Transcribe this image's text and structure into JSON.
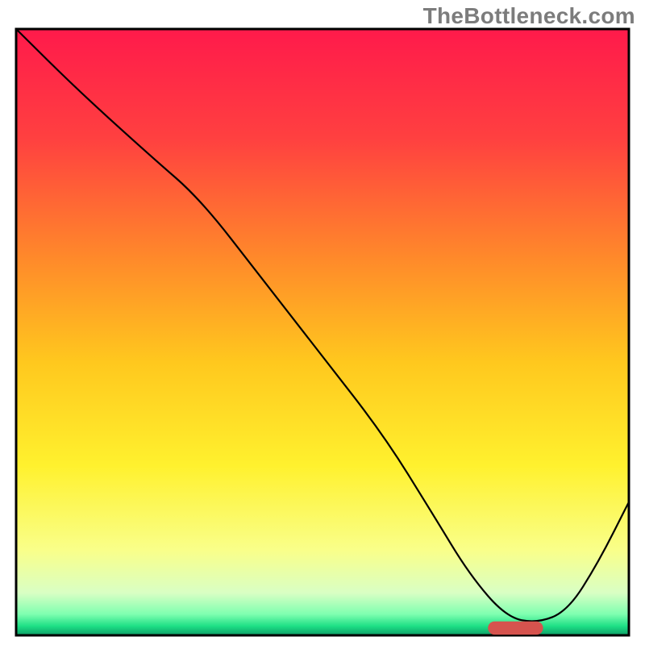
{
  "attribution": "TheBottleneck.com",
  "chart_data": {
    "type": "line",
    "title": "",
    "xlabel": "",
    "ylabel": "",
    "xlim": [
      0,
      100
    ],
    "ylim": [
      0,
      100
    ],
    "background": {
      "type": "vertical-gradient",
      "stops": [
        {
          "offset": 0.0,
          "color": "#ff1a4b"
        },
        {
          "offset": 0.18,
          "color": "#ff4040"
        },
        {
          "offset": 0.38,
          "color": "#ff8a2a"
        },
        {
          "offset": 0.55,
          "color": "#ffc81e"
        },
        {
          "offset": 0.72,
          "color": "#fff12e"
        },
        {
          "offset": 0.86,
          "color": "#f9ff8a"
        },
        {
          "offset": 0.93,
          "color": "#d9ffc4"
        },
        {
          "offset": 0.965,
          "color": "#7fffb0"
        },
        {
          "offset": 0.985,
          "color": "#1ddf85"
        },
        {
          "offset": 1.0,
          "color": "#0e9e66"
        }
      ]
    },
    "series": [
      {
        "name": "curve",
        "color": "#000000",
        "width": 2.2,
        "x": [
          0,
          10,
          22,
          30,
          40,
          50,
          60,
          68,
          74,
          80,
          85,
          90,
          95,
          100
        ],
        "y": [
          100,
          90,
          79,
          72,
          59,
          46,
          33,
          20,
          10,
          3,
          2,
          4,
          12,
          22
        ]
      }
    ],
    "marker": {
      "name": "optimum-range",
      "shape": "rounded-bar",
      "x_start": 77,
      "x_end": 86,
      "y": 1.2,
      "height_pct": 2.2,
      "fill": "#d6534e"
    },
    "frame": {
      "left_pct": 2.5,
      "right_pct": 97.5,
      "top_pct": 4.5,
      "bottom_pct": 98.5,
      "stroke": "#000000",
      "stroke_width": 3
    }
  }
}
